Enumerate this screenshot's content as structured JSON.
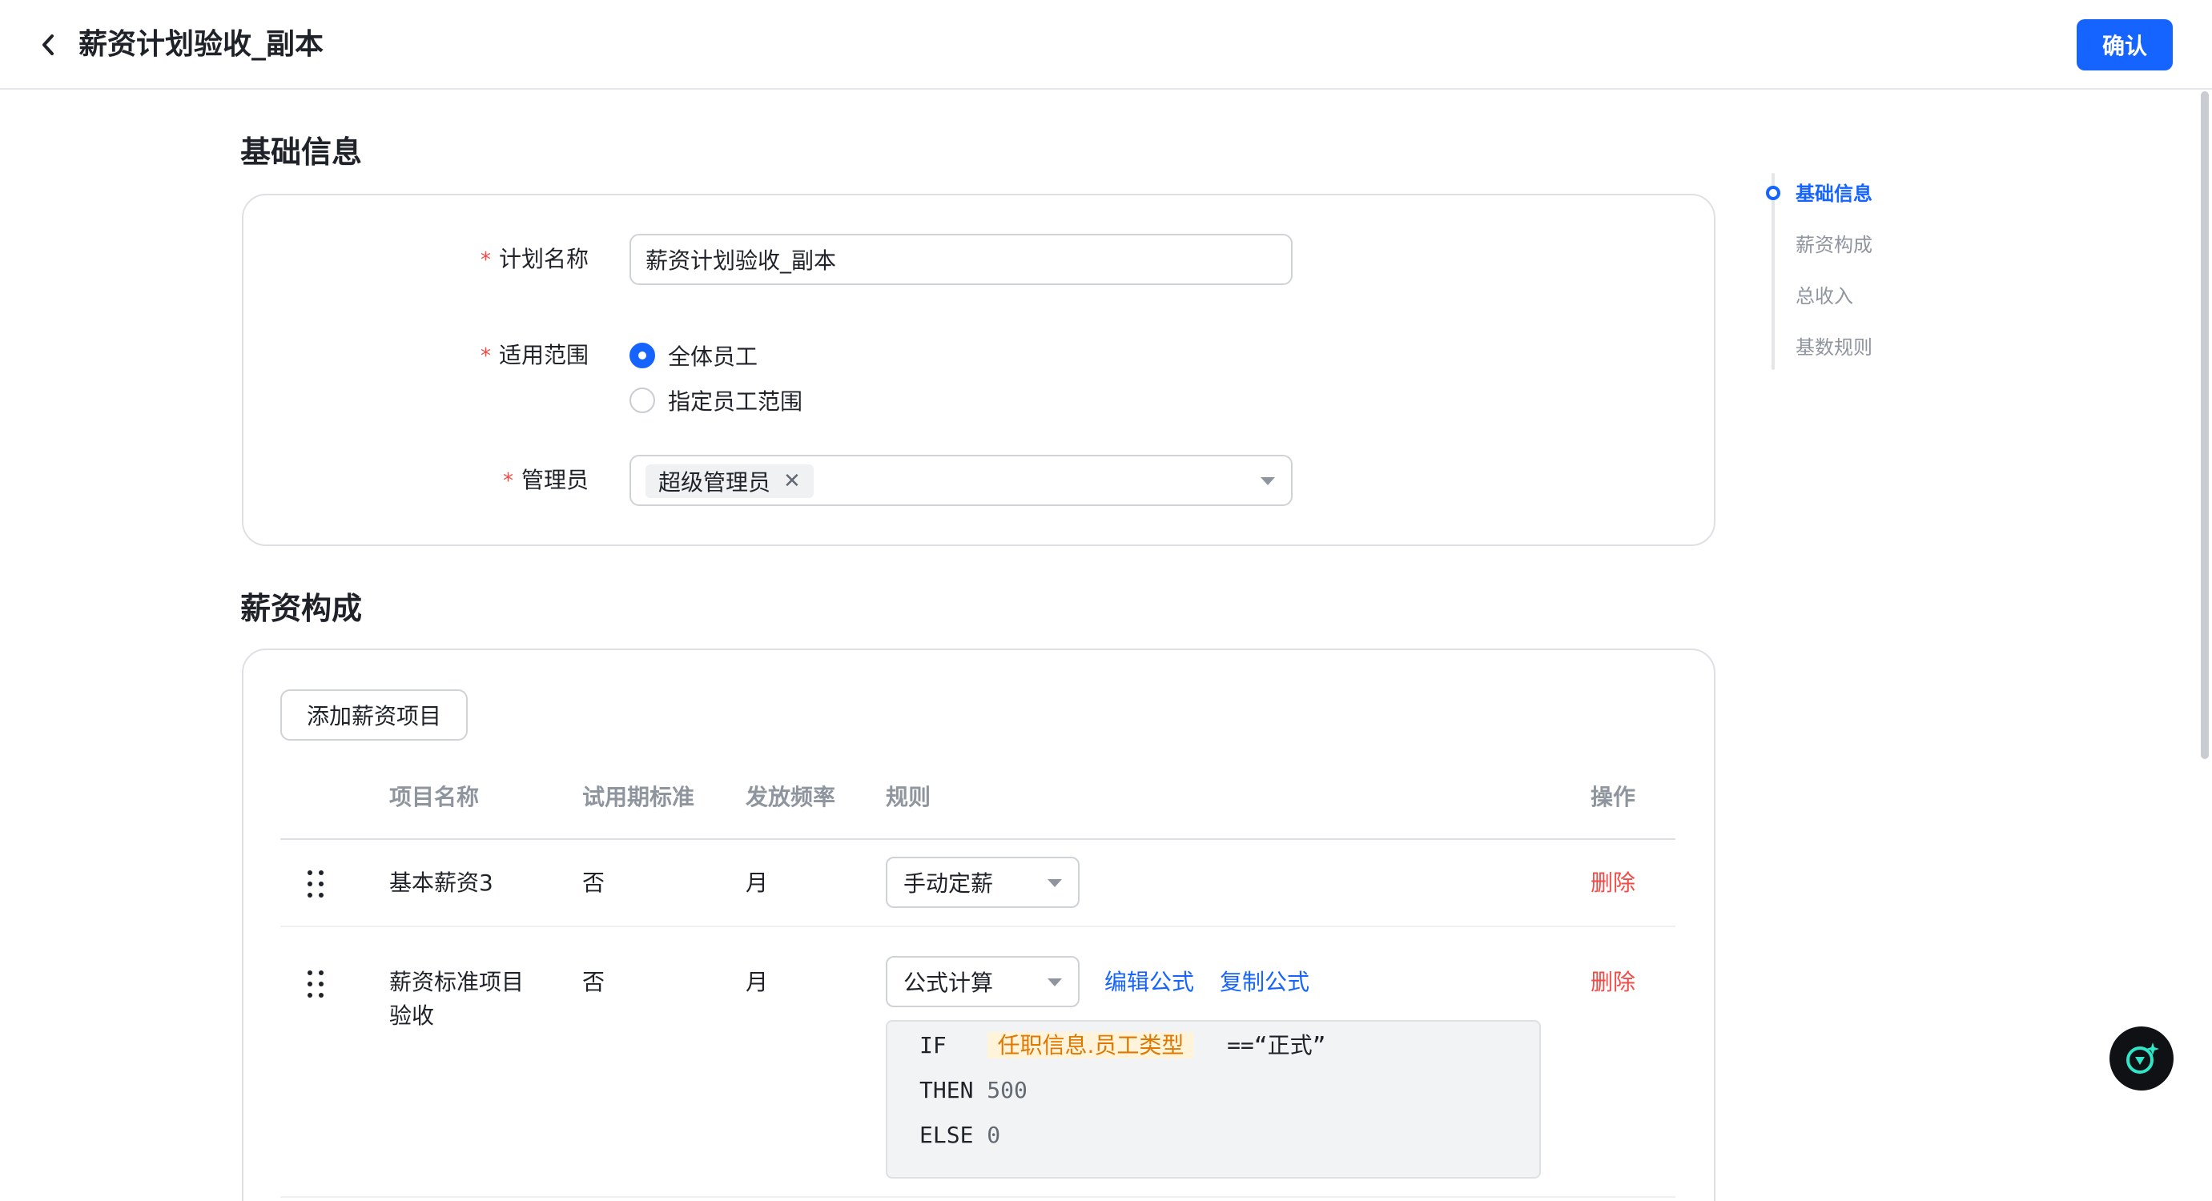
{
  "header": {
    "title": "薪资计划验收_副本",
    "confirm_label": "确认"
  },
  "basic_info": {
    "section_title": "基础信息",
    "plan_name": {
      "label": "计划名称",
      "value": "薪资计划验收_副本"
    },
    "scope": {
      "label": "适用范围",
      "options": [
        {
          "label": "全体员工",
          "checked": true
        },
        {
          "label": "指定员工范围",
          "checked": false
        }
      ]
    },
    "admin": {
      "label": "管理员",
      "tags": [
        "超级管理员"
      ]
    },
    "required_mark": "*"
  },
  "anchor_nav": {
    "items": [
      {
        "label": "基础信息",
        "active": true
      },
      {
        "label": "薪资构成",
        "active": false
      },
      {
        "label": "总收入",
        "active": false
      },
      {
        "label": "基数规则",
        "active": false
      }
    ]
  },
  "salary": {
    "section_title": "薪资构成",
    "add_label": "添加薪资项目",
    "columns": [
      "项目名称",
      "试用期标准",
      "发放频率",
      "规则",
      "操作"
    ],
    "rows": [
      {
        "name": "基本薪资3",
        "probation": "否",
        "frequency": "月",
        "rule": "手动定薪",
        "delete_label": "删除"
      },
      {
        "name_line1": "薪资标准项目",
        "name_line2": "验收",
        "probation": "否",
        "frequency": "月",
        "rule": "公式计算",
        "edit_label": "编辑公式",
        "copy_label": "复制公式",
        "delete_label": "删除",
        "formula": {
          "if_kw": "IF",
          "field": "任职信息.员工类型",
          "condition": "==“正式”",
          "then_kw": "THEN",
          "then_val": "500",
          "else_kw": "ELSE",
          "else_val": "0"
        }
      }
    ]
  },
  "colors": {
    "primary": "#1664ff",
    "danger": "#f54a45",
    "text": "#1f2329",
    "muted": "#8f959e"
  }
}
